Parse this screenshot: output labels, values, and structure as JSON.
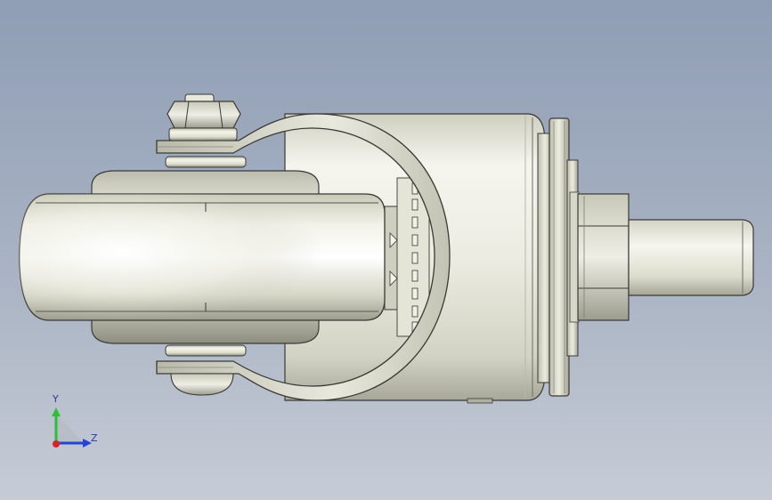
{
  "viewport": {
    "background_top": "#8f9eb5",
    "background_bottom": "#c6ccd6"
  },
  "model": {
    "name": "caster-wheel-assembly",
    "metal_color": "#e7e7dc",
    "metal_shadow": "#9a9a8c",
    "edge_color": "#3a3a36"
  },
  "triad": {
    "y_label": "Y",
    "z_label": "Z",
    "y_color": "#2bbf3a",
    "z_color": "#2346d6",
    "x_color": "#d62323"
  }
}
